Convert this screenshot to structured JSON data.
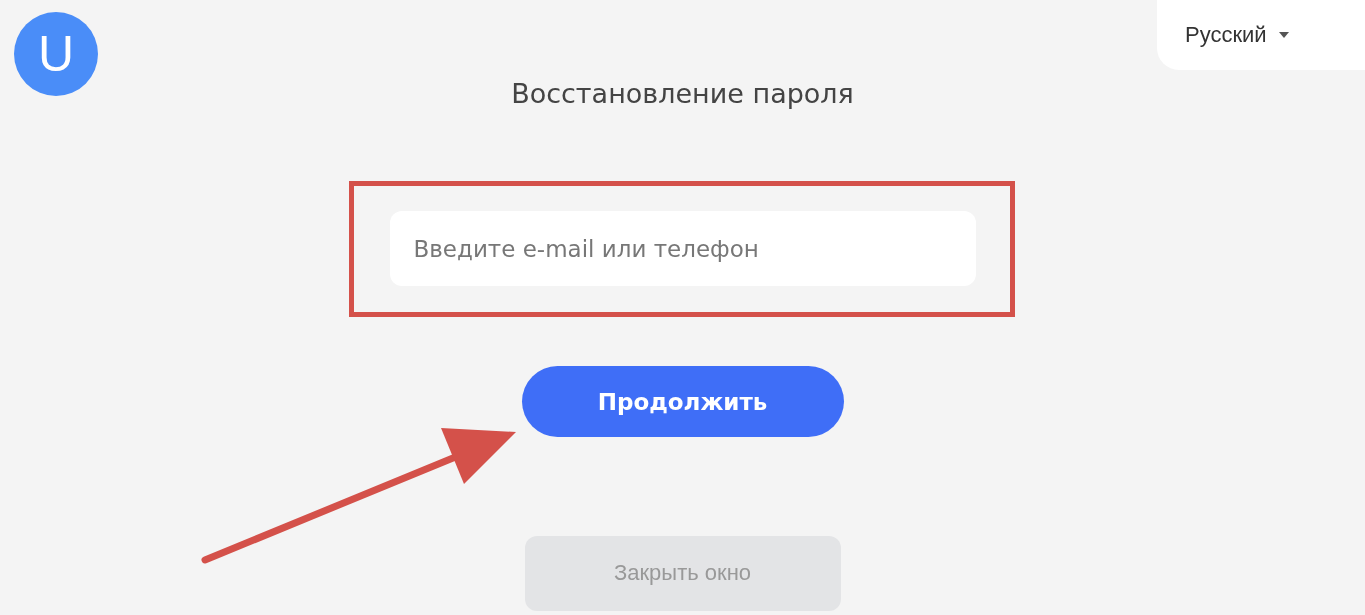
{
  "logo": {
    "letter": "U"
  },
  "language_selector": {
    "label": "Русский"
  },
  "title": "Восстановление пароля",
  "login_field": {
    "placeholder": "Введите e-mail или телефон"
  },
  "continue_button": {
    "label": "Продолжить"
  },
  "close_button": {
    "label": "Закрыть окно",
    "disabled": true
  }
}
